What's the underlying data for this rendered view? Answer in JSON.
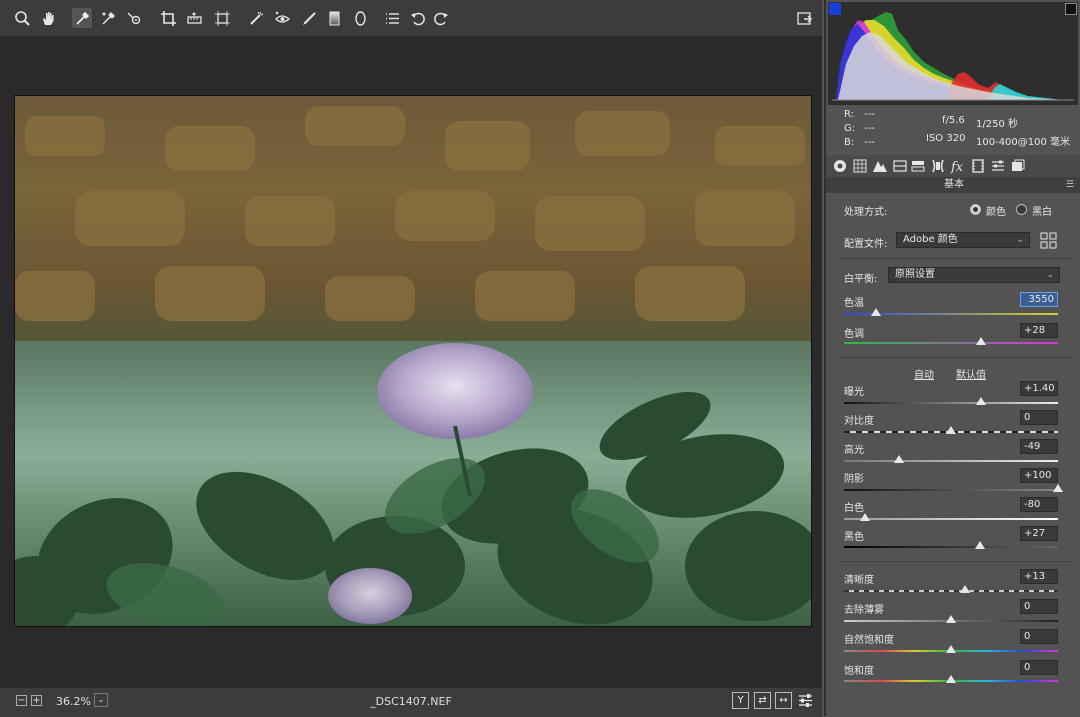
{
  "toolbar": {
    "tools": [
      {
        "name": "zoom-tool",
        "icon": "magnifier-icon"
      },
      {
        "name": "hand-tool",
        "icon": "hand-icon"
      },
      {
        "name": "white-balance-tool",
        "icon": "eyedropper-icon",
        "active": true
      },
      {
        "name": "color-sampler-tool",
        "icon": "color-sampler-icon"
      },
      {
        "name": "targeted-adjustment-tool",
        "icon": "target-adjust-icon"
      },
      {
        "name": "crop-tool",
        "icon": "crop-icon"
      },
      {
        "name": "straighten-tool",
        "icon": "straighten-icon"
      },
      {
        "name": "transform-tool",
        "icon": "transform-icon"
      },
      {
        "name": "spot-removal-tool",
        "icon": "spot-removal-icon"
      },
      {
        "name": "red-eye-tool",
        "icon": "red-eye-icon"
      },
      {
        "name": "adjustment-brush-tool",
        "icon": "brush-icon"
      },
      {
        "name": "graduated-filter-tool",
        "icon": "graduated-filter-icon"
      },
      {
        "name": "radial-filter-tool",
        "icon": "radial-filter-icon"
      },
      {
        "name": "preferences-tool",
        "icon": "list-icon"
      },
      {
        "name": "rotate-left-tool",
        "icon": "rotate-ccw-icon"
      },
      {
        "name": "rotate-right-tool",
        "icon": "rotate-cw-icon"
      }
    ],
    "fullscreen_icon": "fullscreen-icon"
  },
  "statusbar": {
    "zoom_out": "−",
    "zoom_in": "+",
    "zoom": "36.2%",
    "zoom_chevron": "⌄",
    "filename": "_DSC1407.NEF",
    "view_y": "Y",
    "view_swap": "⇄",
    "view_copy": "↔",
    "view_settings_icon": "sliders-icon"
  },
  "info": {
    "r_label": "R:",
    "r_val": "---",
    "g_label": "G:",
    "g_val": "---",
    "b_label": "B:",
    "b_val": "---",
    "aperture": "f/5.6",
    "shutter": "1/250 秒",
    "iso": "ISO 320",
    "lens": "100-400@100 毫米"
  },
  "panel": {
    "title": "基本",
    "process_label": "处理方式:",
    "process_color": "颜色",
    "process_bw": "黑白",
    "profile_label": "配置文件:",
    "profile_value": "Adobe 颜色",
    "wb_label": "白平衡:",
    "wb_value": "原照设置",
    "auto": "自动",
    "default": "默认值"
  },
  "sliders": {
    "temp": {
      "label": "色温",
      "value": "3550",
      "pos": 0.15
    },
    "tint": {
      "label": "色调",
      "value": "+28",
      "pos": 0.64
    },
    "exposure": {
      "label": "曝光",
      "value": "+1.40",
      "pos": 0.64
    },
    "contrast": {
      "label": "对比度",
      "value": "0",
      "pos": 0.5
    },
    "highlights": {
      "label": "高光",
      "value": "-49",
      "pos": 0.255
    },
    "shadows": {
      "label": "阴影",
      "value": "+100",
      "pos": 1.0
    },
    "whites": {
      "label": "白色",
      "value": "-80",
      "pos": 0.1
    },
    "blacks": {
      "label": "黑色",
      "value": "+27",
      "pos": 0.635
    },
    "clarity": {
      "label": "清晰度",
      "value": "+13",
      "pos": 0.565
    },
    "dehaze": {
      "label": "去除薄雾",
      "value": "0",
      "pos": 0.5
    },
    "vibrance": {
      "label": "自然饱和度",
      "value": "0",
      "pos": 0.5
    },
    "saturation": {
      "label": "饱和度",
      "value": "0",
      "pos": 0.5
    }
  },
  "colors": {
    "accent": "#3b5f92",
    "panel": "#535353",
    "canvas": "#2a2a2a"
  }
}
